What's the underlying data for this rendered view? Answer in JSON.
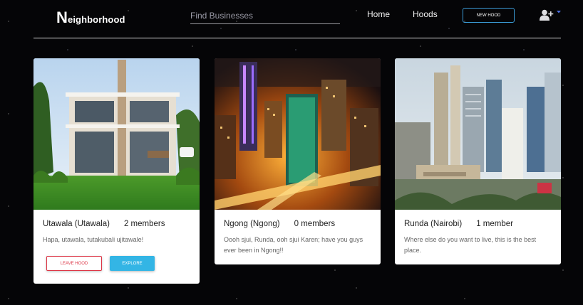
{
  "header": {
    "logo_initial": "N",
    "logo_rest": "eighborhood",
    "search_placeholder": "Find Businesses",
    "nav": {
      "home": "Home",
      "hoods": "Hoods"
    },
    "new_hood_label": "NEW HOOD",
    "user_icon": "user-plus-icon",
    "dropdown_icon": "caret-down-icon"
  },
  "colors": {
    "background": "#050507",
    "accent": "#33b5e5",
    "danger": "#dc3545",
    "new_hood_border": "#3b9bd6"
  },
  "hoods": [
    {
      "name": "Utawala (Utawala)",
      "members": "2 members",
      "description": "Hapa, utawala, tutakubali ujitawale!",
      "leave_label": "LEAVE HOOD",
      "explore_label": "EXPLORE"
    },
    {
      "name": "Ngong (Ngong)",
      "members": "0 members",
      "description": "Oooh sjui, Runda, ooh sjui Karen; have you guys ever been in Ngong!!"
    },
    {
      "name": "Runda (Nairobi)",
      "members": "1 member",
      "description": "Where else do you want to live, this is the best place."
    }
  ]
}
